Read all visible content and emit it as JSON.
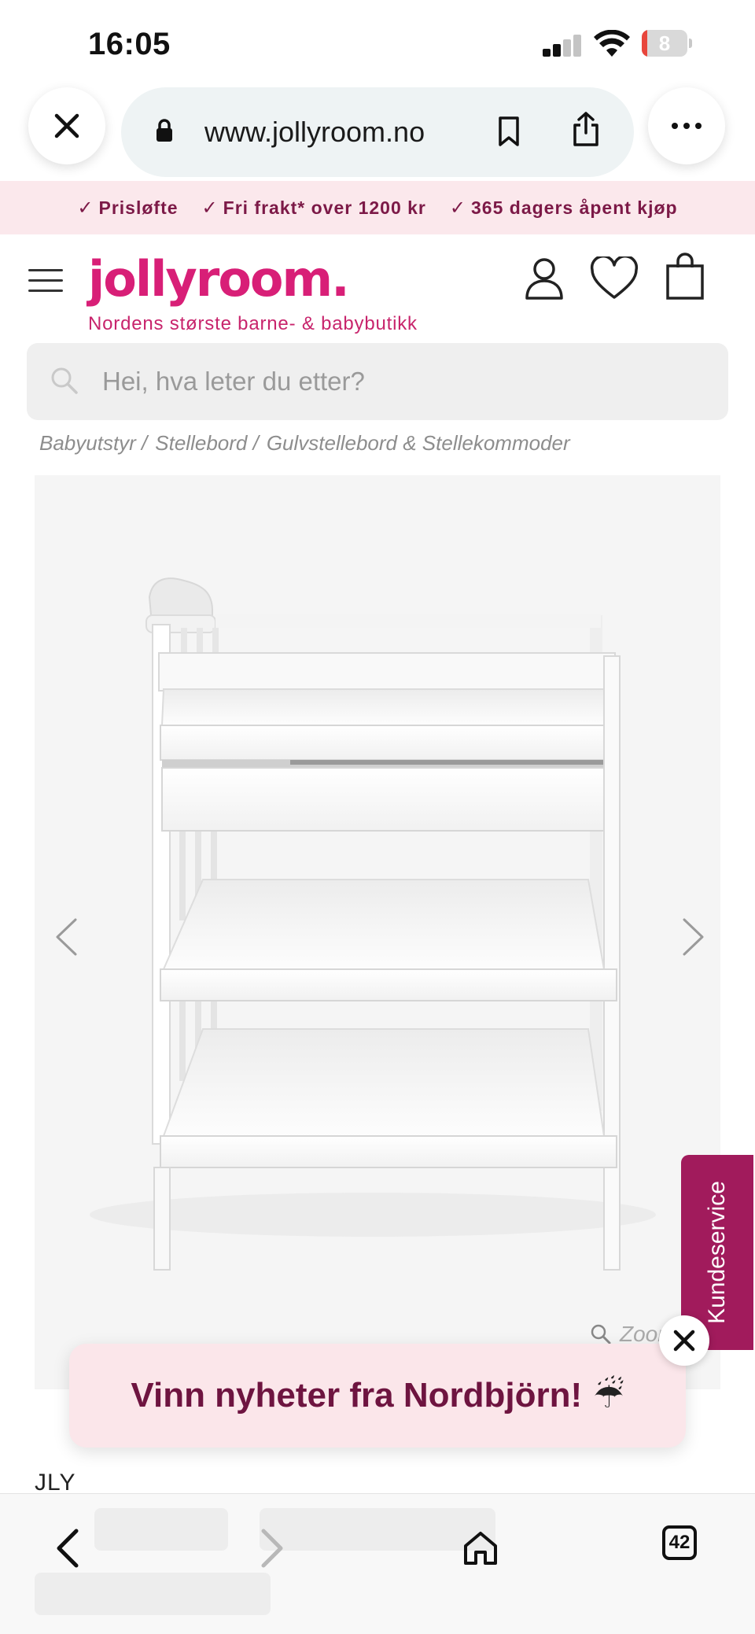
{
  "status_bar": {
    "time": "16:05",
    "battery_level": "8",
    "battery_fraction": 0.08,
    "signal_icon": "cellular-signal-icon",
    "wifi_icon": "wifi-icon"
  },
  "browser": {
    "url": "www.jollyroom.no",
    "close_icon": "close-icon",
    "lock_icon": "lock-icon",
    "bookmark_icon": "bookmark-icon",
    "share_icon": "share-icon",
    "more_icon": "more-icon"
  },
  "promo_strip": {
    "items": [
      "Prisløfte",
      "Fri frakt* over 1200 kr",
      "365 dagers åpent kjøp"
    ]
  },
  "header": {
    "logo": "jollyroom.",
    "tagline": "Nordens største barne- & babybutikk",
    "icons": [
      "menu-icon",
      "account-icon",
      "wishlist-heart-icon",
      "cart-bag-icon"
    ]
  },
  "search": {
    "placeholder": "Hei, hva leter du etter?"
  },
  "breadcrumb": {
    "items": [
      "Babyutstyr /",
      "Stellebord /",
      "Gulvstellebord & Stellekommoder"
    ]
  },
  "gallery": {
    "zoom_label": "Zoom"
  },
  "kundeservice": {
    "label": "Kundeservice"
  },
  "popup": {
    "text": "Vinn nyheter fra Nordbjörn!",
    "emoji": "☔"
  },
  "product": {
    "brand": "JLY"
  },
  "toolbar": {
    "tabs_count": "42"
  },
  "colors": {
    "brand_pink": "#d81f77",
    "promo_text": "#7c1947",
    "promo_bg": "#fbe8ec",
    "kundeservice_bg": "#a11b5c"
  }
}
